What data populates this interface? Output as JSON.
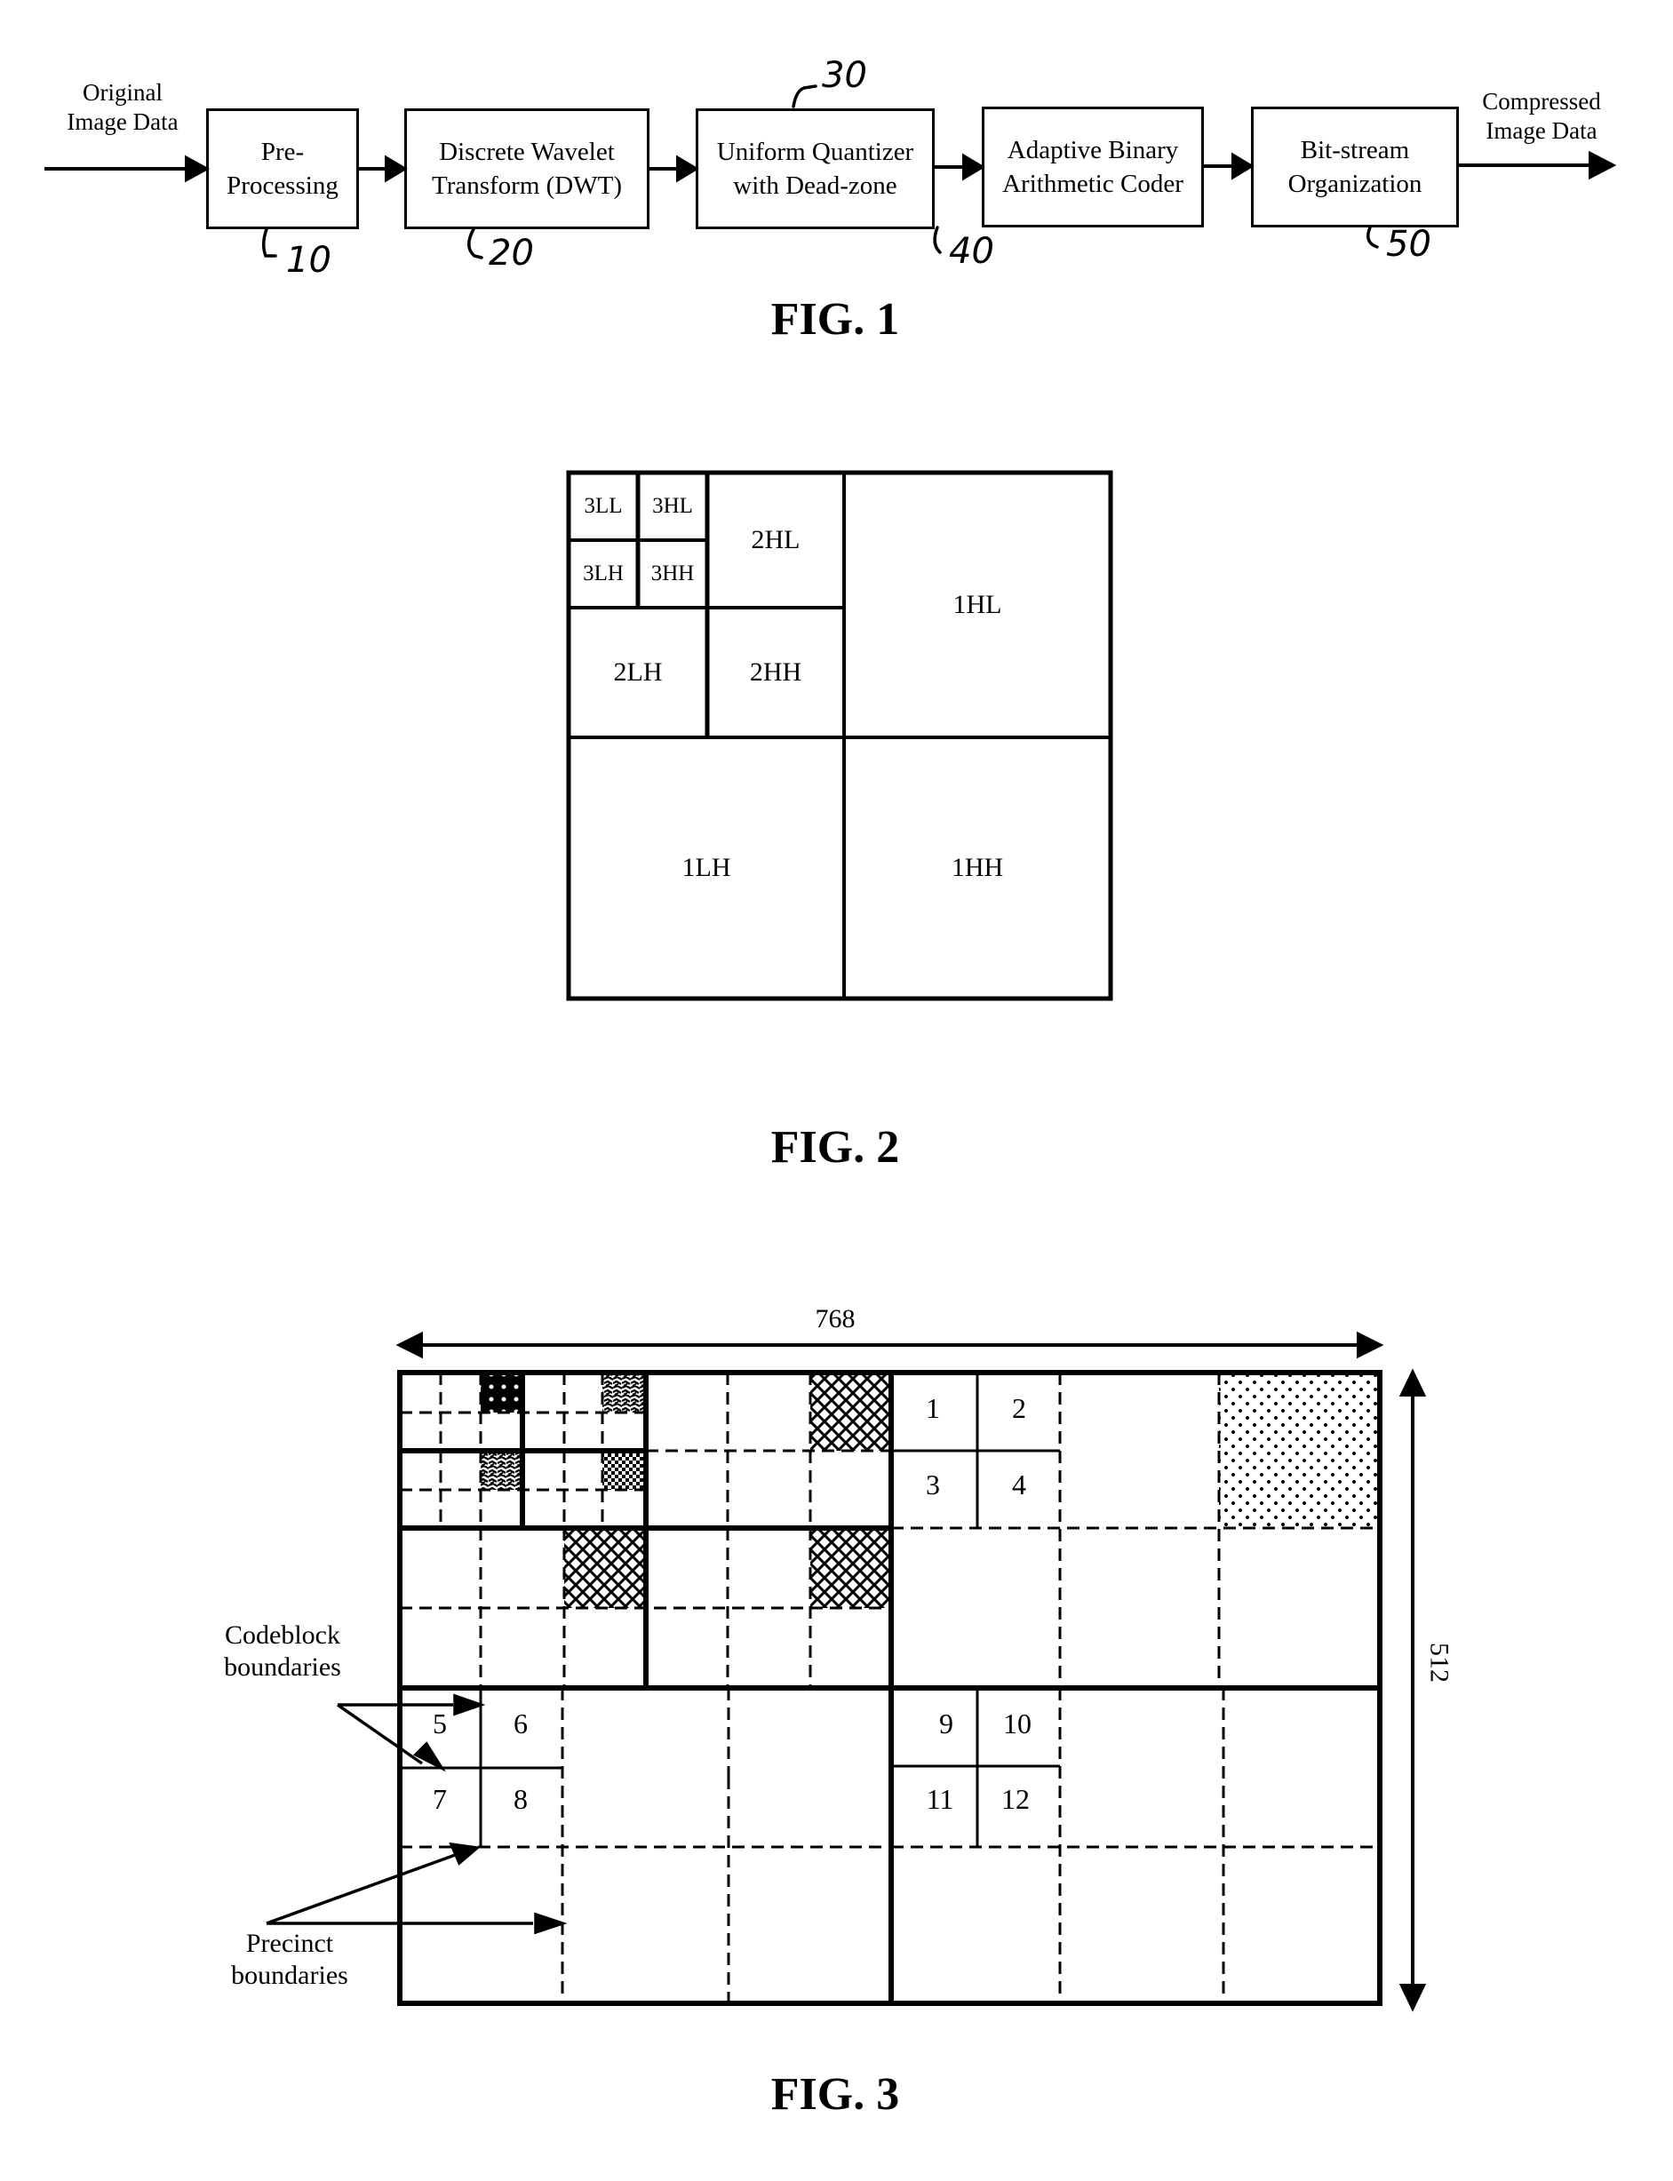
{
  "fig1": {
    "caption": "FIG. 1",
    "input_label": [
      "Original",
      "Image Data"
    ],
    "output_label": [
      "Compressed",
      "Image Data"
    ],
    "blocks": [
      {
        "lines": [
          "Pre-",
          "Processing"
        ],
        "ref": "10"
      },
      {
        "lines": [
          "Discrete Wavelet",
          "Transform (DWT)"
        ],
        "ref": "20"
      },
      {
        "lines": [
          "Uniform Quantizer",
          "with Dead-zone"
        ],
        "ref": "30"
      },
      {
        "lines": [
          "Adaptive Binary",
          "Arithmetic Coder"
        ],
        "ref": "40"
      },
      {
        "lines": [
          "Bit-stream",
          "Organization"
        ],
        "ref": "50"
      }
    ]
  },
  "fig2": {
    "caption": "FIG. 2",
    "subbands": {
      "LL3": "3LL",
      "HL3": "3HL",
      "LH3": "3LH",
      "HH3": "3HH",
      "HL2": "2HL",
      "LH2": "2LH",
      "HH2": "2HH",
      "HL1": "1HL",
      "LH1": "1LH",
      "HH1": "1HH"
    }
  },
  "fig3": {
    "caption": "FIG. 3",
    "width_label": "768",
    "height_label": "512",
    "codeblock_label": [
      "Codeblock",
      "boundaries"
    ],
    "precinct_label": [
      "Precinct",
      "boundaries"
    ],
    "codeblock_numbers": [
      "1",
      "2",
      "3",
      "4",
      "5",
      "6",
      "7",
      "8",
      "9",
      "10",
      "11",
      "12"
    ]
  }
}
